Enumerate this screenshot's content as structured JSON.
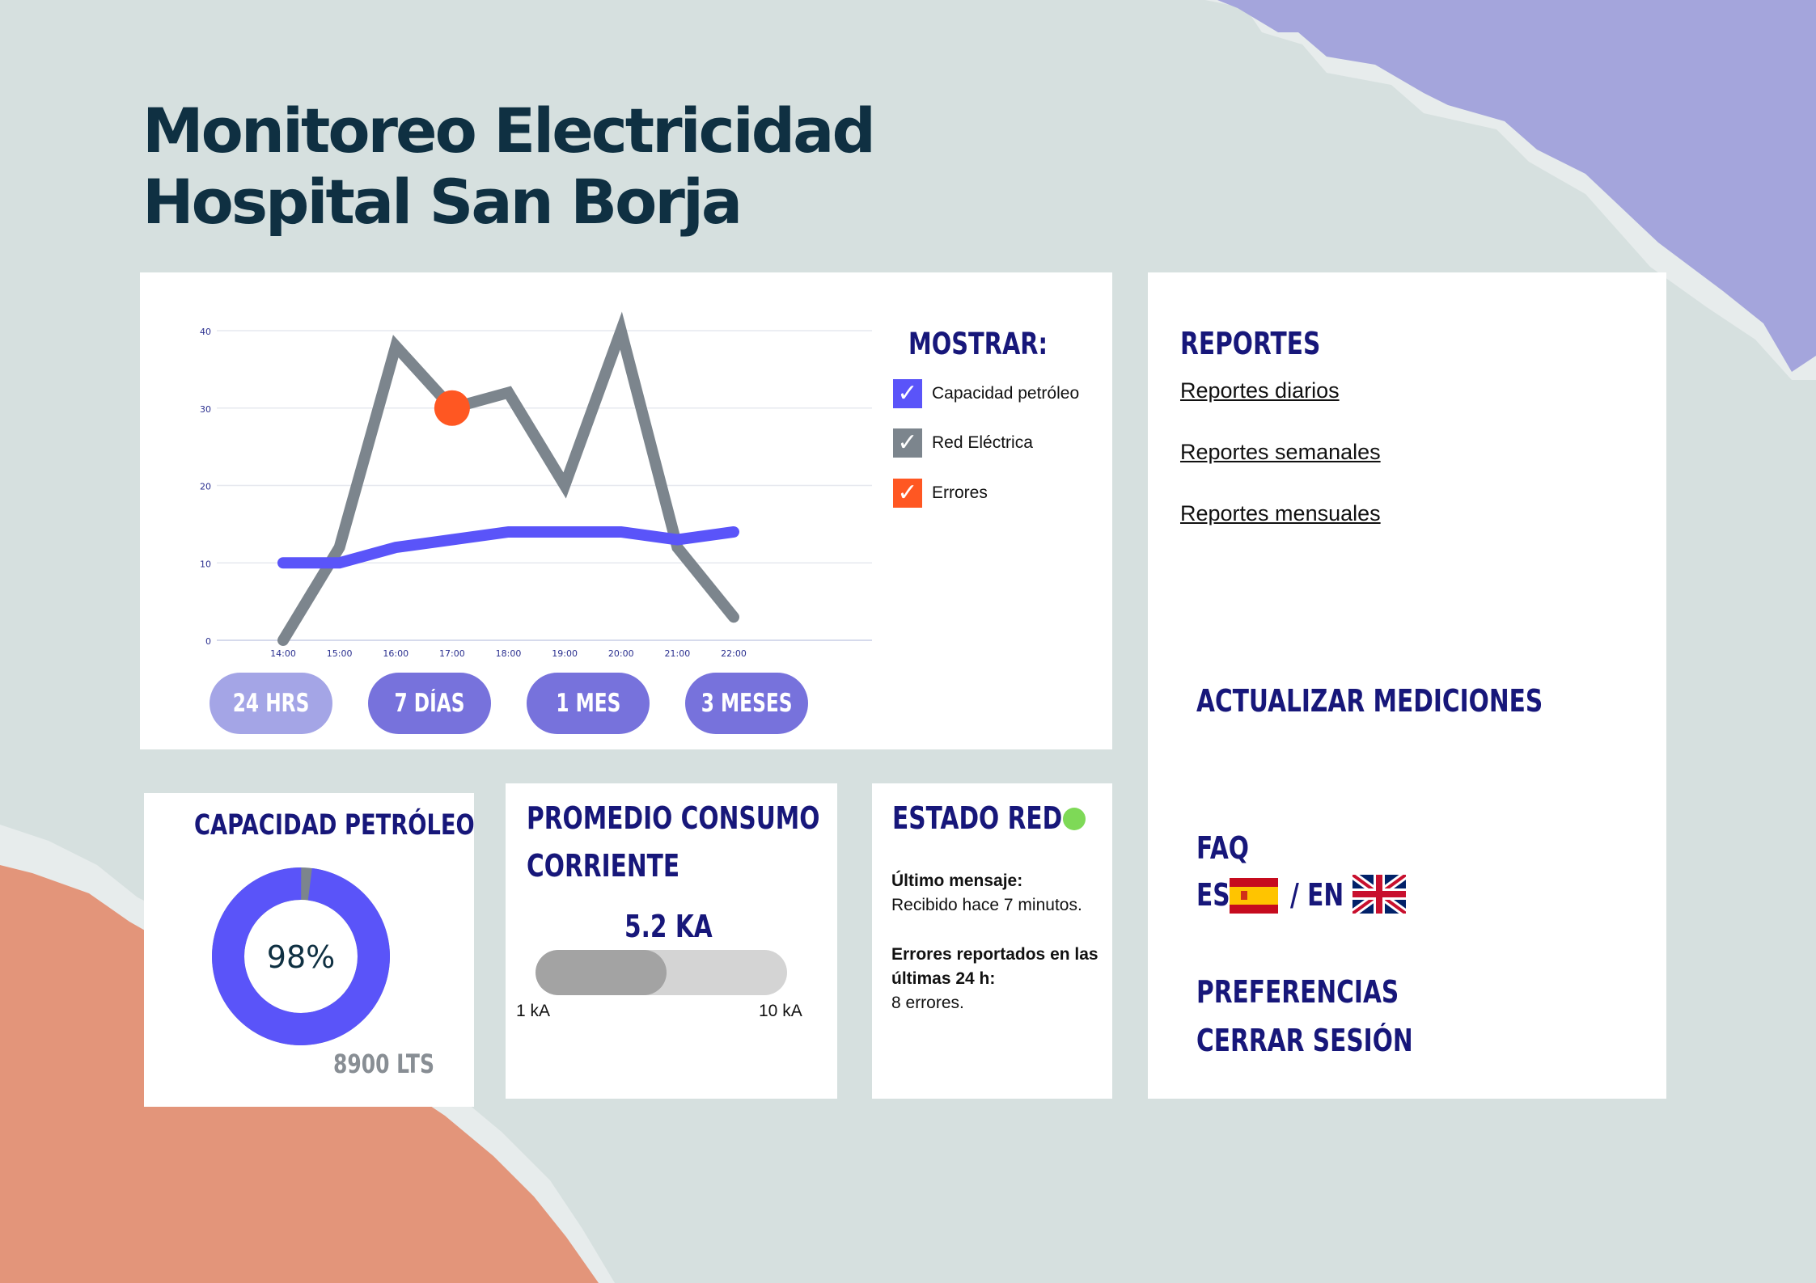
{
  "title": {
    "line1": "Monitoreo Electricidad",
    "line2": "Hospital San Borja"
  },
  "colors": {
    "background": "#d6e0df",
    "accent_purple": "#5a54f9",
    "series_gray": "#7c858d",
    "error_orange": "#ff5722",
    "status_ok": "#7ed957",
    "heading_navy": "#17177a",
    "title_dark": "#0f3042",
    "deco_purple": "#a4a5dc",
    "deco_salmon": "#e3957a"
  },
  "chart": {
    "legend_title": "MOSTRAR:",
    "legend": [
      {
        "label": "Capacidad petróleo",
        "color": "#5a54f9",
        "checked": true,
        "icon": "check-icon"
      },
      {
        "label": "Red Eléctrica",
        "color": "#7c858d",
        "checked": true,
        "icon": "check-icon"
      },
      {
        "label": "Errores",
        "color": "#ff5722",
        "checked": true,
        "icon": "check-icon"
      }
    ],
    "range_buttons": [
      {
        "label": "24 HRS",
        "color": "#a4a5e6",
        "selected": false
      },
      {
        "label": "7 DÍAS",
        "color": "#7772dc",
        "selected": false
      },
      {
        "label": "1 MES",
        "color": "#7772dc",
        "selected": false
      },
      {
        "label": "3 MESES",
        "color": "#7772dc",
        "selected": false
      }
    ]
  },
  "chart_data": {
    "type": "line",
    "title": "",
    "xlabel": "",
    "ylabel": "",
    "x": [
      "14:00",
      "15:00",
      "16:00",
      "17:00",
      "18:00",
      "19:00",
      "20:00",
      "21:00",
      "22:00"
    ],
    "yticks": [
      0,
      10,
      20,
      30,
      40
    ],
    "ylim": [
      0,
      40
    ],
    "grid": true,
    "series": [
      {
        "name": "Capacidad petróleo",
        "color": "#5a54f9",
        "values": [
          10,
          10,
          12,
          13,
          14,
          14,
          14,
          13,
          14
        ]
      },
      {
        "name": "Red Eléctrica",
        "color": "#7c858d",
        "values": [
          0,
          12,
          38,
          30,
          32,
          20,
          40,
          12,
          3
        ]
      }
    ],
    "markers": [
      {
        "name": "Errores",
        "color": "#ff5722",
        "x": "17:00",
        "y": 30
      }
    ]
  },
  "reports": {
    "title": "REPORTES",
    "links": [
      "Reportes diarios",
      "Reportes semanales",
      "Reportes mensuales"
    ]
  },
  "sidebar": {
    "refresh": "ACTUALIZAR MEDICIONES",
    "faq": "FAQ",
    "lang_es": "ES",
    "lang_separator": "/ EN",
    "preferences": "PREFERENCIAS",
    "logout": "CERRAR SESIÓN"
  },
  "fuel": {
    "title": "CAPACIDAD PETRÓLEO",
    "percent_label": "98%",
    "percent_value": 0.98,
    "volume": "8900 LTS"
  },
  "current": {
    "title_line1": "PROMEDIO CONSUMO",
    "title_line2": "CORRIENTE",
    "value_label": "5.2 KA",
    "fill_fraction": 0.52,
    "min_label": "1 kA",
    "max_label": "10 kA"
  },
  "network": {
    "title": "ESTADO RED",
    "status_color": "#7ed957",
    "last_message_label": "Último mensaje:",
    "last_message_text": "Recibido hace 7 minutos.",
    "errors_label": "Errores reportados en las últimas 24 h:",
    "errors_text": "8 errores."
  }
}
